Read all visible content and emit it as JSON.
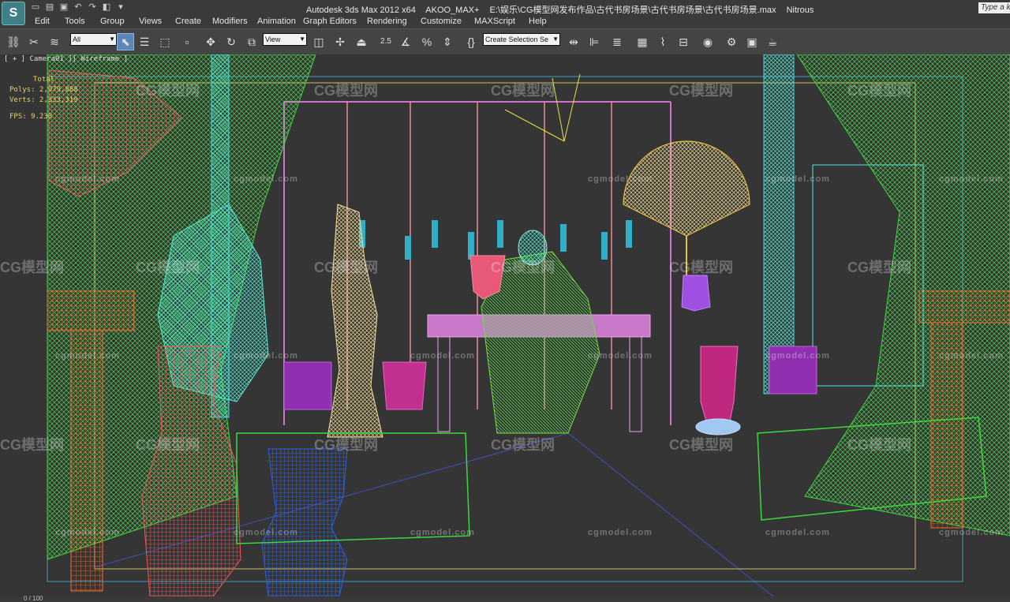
{
  "titlebar": {
    "app": "Autodesk 3ds Max  2012 x64",
    "user": "AKOO_MAX+",
    "file": "E:\\娱乐\\CG模型网发布作品\\古代书房场景\\古代书房场景\\古代书房场景.max",
    "renderer": "Nitrous",
    "search_placeholder": "Type a k"
  },
  "menu": [
    "Edit",
    "Tools",
    "Group",
    "Views",
    "Create",
    "Modifiers",
    "Animation",
    "Graph Editors",
    "Rendering",
    "Customize",
    "MAXScript",
    "Help"
  ],
  "toolbar": {
    "filter": "All",
    "coord": "View",
    "snap": "2.5",
    "selection_set": "Create Selection Se"
  },
  "viewport": {
    "label": "[ + ] Camera01 ][ Wireframe ]",
    "stats_total": "Total",
    "stats_polys": "Polys:  2,979,888",
    "stats_verts": "Verts:  2,333,319",
    "stats_fps": "FPS:   9.230"
  },
  "watermark": {
    "en": "cgmodel.com",
    "cn": "CG模型网"
  },
  "status": {
    "frame": "0 / 100"
  }
}
